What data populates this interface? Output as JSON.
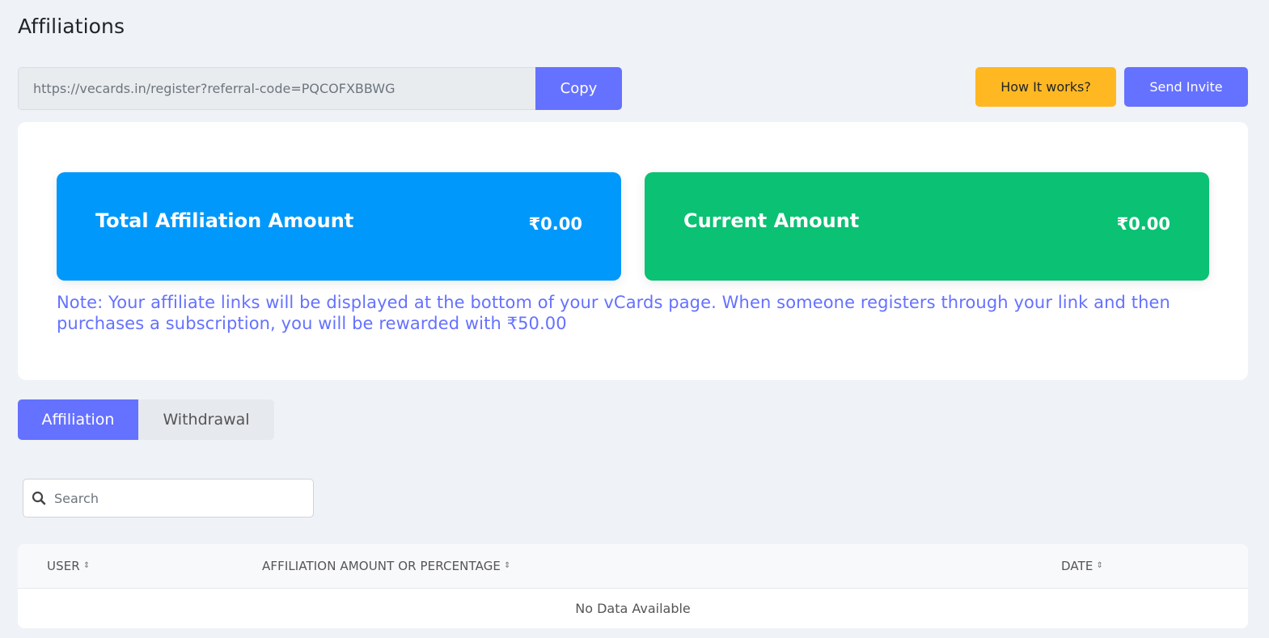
{
  "page": {
    "title": "Affiliations"
  },
  "referral": {
    "link": "https://vecards.in/register?referral-code=PQCOFXBBWG",
    "copy_label": "Copy"
  },
  "actions": {
    "how_label": "How It works?",
    "invite_label": "Send Invite"
  },
  "stats": {
    "total_label": "Total Affiliation Amount",
    "total_value": "₹0.00",
    "current_label": "Current Amount",
    "current_value": "₹0.00"
  },
  "note": "Note: Your affiliate links will be displayed at the bottom of your vCards page. When someone registers through your link and then purchases a subscription, you will be rewarded with ₹50.00",
  "tabs": [
    {
      "label": "Affiliation",
      "active": true
    },
    {
      "label": "Withdrawal",
      "active": false
    }
  ],
  "search": {
    "placeholder": "Search",
    "value": ""
  },
  "table": {
    "columns": [
      "USER",
      "AFFILIATION AMOUNT OR PERCENTAGE",
      "DATE"
    ],
    "empty_text": "No Data Available"
  },
  "colors": {
    "primary": "#6571ff",
    "warning": "#ffb822",
    "blue_card": "#0099fb",
    "green_card": "#0bc173"
  }
}
